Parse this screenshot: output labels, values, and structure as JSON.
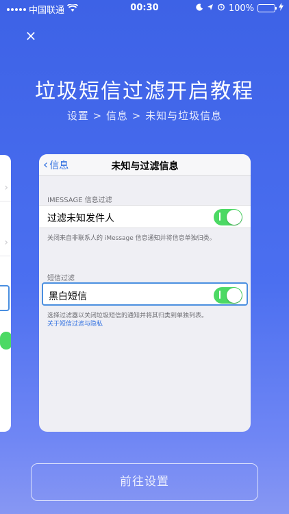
{
  "status_bar": {
    "carrier": "中国联通",
    "time": "00:30",
    "battery": "100%",
    "battery_color": "#4cd964"
  },
  "close_label": "×",
  "title": "垃圾短信过滤开启教程",
  "breadcrumb": "设置 > 信息 > 未知与垃圾信息",
  "card": {
    "back_label": "信息",
    "nav_title": "未知与过滤信息",
    "section1_header": "IMESSAGE 信息过滤",
    "row1_label": "过滤未知发件人",
    "row1_footnote": "关闭来自非联系人的 iMessage 信息通知并将信息单独归类。",
    "section2_header": "短信过滤",
    "row2_label": "黑白短信",
    "row2_footnote": "选择过滤器以关闭垃圾短信的通知并将其归类到单独列表。",
    "row2_link": "关于短信过滤与隐私",
    "toggle_color": "#4cd964",
    "highlight_color": "#4a8fe0"
  },
  "go_button": "前往设置",
  "background_colors": [
    "#3d62e6",
    "#8797f3"
  ]
}
